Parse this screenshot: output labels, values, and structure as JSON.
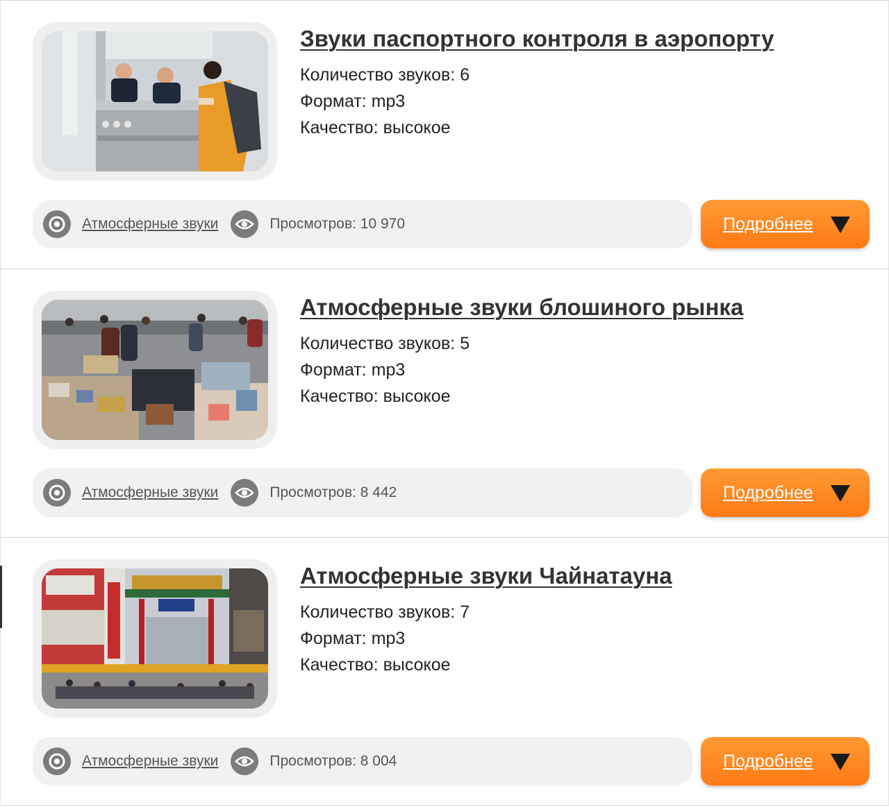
{
  "category_label": "Атмосферные звуки",
  "more_label": "Подробнее",
  "items": [
    {
      "title": "Звуки паспортного контроля в аэропорту",
      "count": "Количество звуков: 6",
      "format": "Формат: mp3",
      "quality": "Качество: высокое",
      "views": "Просмотров: 10 970",
      "image": "airport-passport-control-photo"
    },
    {
      "title": "Атмосферные звуки блошиного рынка",
      "count": "Количество звуков: 5",
      "format": "Формат: mp3",
      "quality": "Качество: высокое",
      "views": "Просмотров: 8 442",
      "image": "flea-market-photo"
    },
    {
      "title": "Атмосферные звуки Чайнатауна",
      "count": "Количество звуков: 7",
      "format": "Формат: mp3",
      "quality": "Качество: высокое",
      "views": "Просмотров: 8 004",
      "image": "chinatown-gate-photo"
    }
  ],
  "colors": {
    "accent": "#ff8a1f",
    "bar_bg": "#f1f1f1",
    "icon_grey": "#7c7c7c"
  }
}
